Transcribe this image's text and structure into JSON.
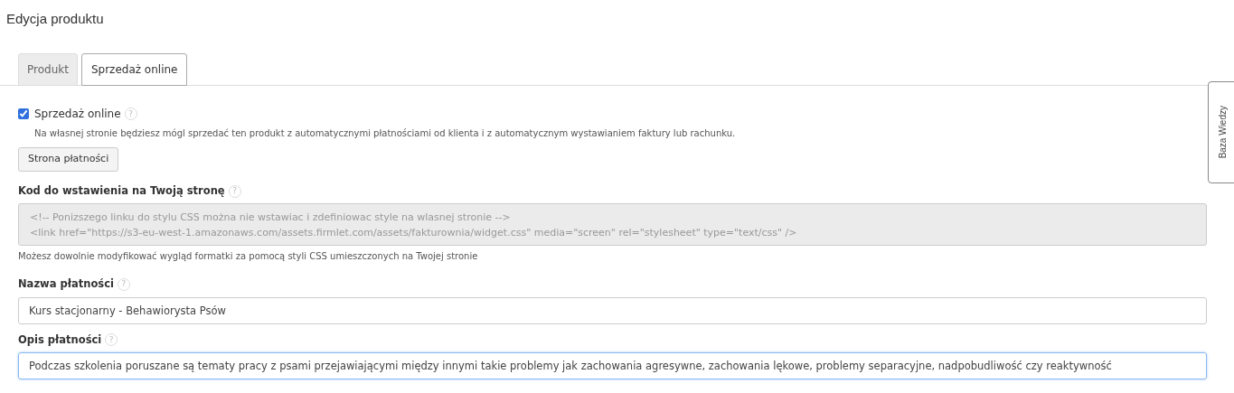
{
  "page_title": "Edycja produktu",
  "tabs": [
    {
      "label": "Produkt",
      "selected": false
    },
    {
      "label": "Sprzedaż online",
      "selected": true
    }
  ],
  "online_sale": {
    "label": "Sprzedaż online",
    "checked": true,
    "help": "?",
    "description": "Na własnej stronie będziesz mógl sprzedać ten produkt z automatycznymi płatnościami od klienta i z automatycznym wystawianiem faktury lub rachunku."
  },
  "payment_page_button": "Strona płatności",
  "embed_code": {
    "label": "Kod do wstawienia na Twoją stronę",
    "help": "?",
    "lines": [
      "<!-- Ponizszego linku do stylu CSS można nie wstawiac i zdefiniowac style na wlasnej stronie -->",
      "<link href=\"https://s3-eu-west-1.amazonaws.com/assets.firmlet.com/assets/fakturownia/widget.css\" media=\"screen\" rel=\"stylesheet\" type=\"text/css\" />"
    ],
    "hint": "Możesz dowolnie modyfikować wygląd formatki za pomocą styli CSS umieszczonych na Twojej stronie"
  },
  "payment_name": {
    "label": "Nazwa płatności",
    "help": "?",
    "value": "Kurs stacjonarny - Behawiorysta Psów"
  },
  "payment_description": {
    "label": "Opis płatności",
    "help": "?",
    "value": "Podczas szkolenia poruszane są tematy pracy z psami przejawiającymi między innymi takie problemy jak zachowania agresywne, zachowania lękowe, problemy separacyjne, nadpobudliwość czy reaktywność",
    "focused": true
  },
  "side_tab": "Baza Wiedzy"
}
